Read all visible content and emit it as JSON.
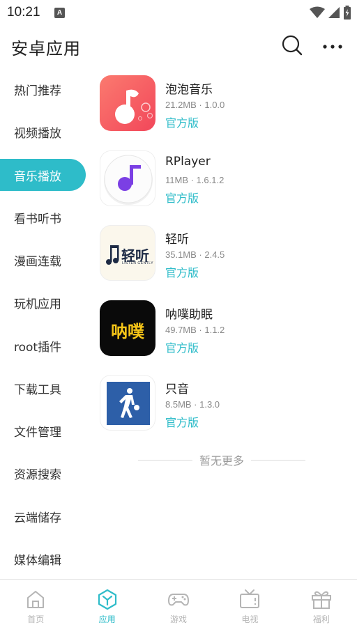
{
  "status_bar": {
    "time": "10:21",
    "notification_badge": "A"
  },
  "header": {
    "title": "安卓应用"
  },
  "sidebar": {
    "items": [
      {
        "label": "热门推荐",
        "active": false
      },
      {
        "label": "视频播放",
        "active": false
      },
      {
        "label": "音乐播放",
        "active": true
      },
      {
        "label": "看书听书",
        "active": false
      },
      {
        "label": "漫画连载",
        "active": false
      },
      {
        "label": "玩机应用",
        "active": false
      },
      {
        "label": "root插件",
        "active": false
      },
      {
        "label": "下载工具",
        "active": false
      },
      {
        "label": "文件管理",
        "active": false
      },
      {
        "label": "资源搜索",
        "active": false
      },
      {
        "label": "云端储存",
        "active": false
      },
      {
        "label": "媒体编辑",
        "active": false
      }
    ]
  },
  "apps": [
    {
      "name": "泡泡音乐",
      "meta": "21.2MB · 1.0.0",
      "badge": "官方版",
      "icon": "bubble-music-icon"
    },
    {
      "name": "RPlayer",
      "meta": "11MB · 1.6.1.2",
      "badge": "官方版",
      "icon": "rplayer-note-icon"
    },
    {
      "name": "轻听",
      "meta": "35.1MB · 2.4.5",
      "badge": "官方版",
      "icon": "qingting-logo-icon",
      "logo_text": "轻听",
      "logo_sub": "LISTEN GENTLY"
    },
    {
      "name": "呐噗助眠",
      "meta": "49.7MB · 1.1.2",
      "badge": "官方版",
      "icon": "napu-logo-icon",
      "logo_text": "呐噗"
    },
    {
      "name": "只音",
      "meta": "8.5MB · 1.3.0",
      "badge": "官方版",
      "icon": "basketball-player-icon"
    }
  ],
  "list_footer": "暂无更多",
  "bottom_nav": [
    {
      "label": "首页",
      "icon": "home-icon",
      "active": false
    },
    {
      "label": "应用",
      "icon": "apps-hex-icon",
      "active": true
    },
    {
      "label": "游戏",
      "icon": "gamepad-icon",
      "active": false
    },
    {
      "label": "电视",
      "icon": "tv-icon",
      "active": false
    },
    {
      "label": "福利",
      "icon": "gift-icon",
      "active": false
    }
  ],
  "colors": {
    "accent": "#2ebcc9",
    "inactive_nav": "#b5b5b5",
    "text": "#222222",
    "meta": "#888888"
  }
}
